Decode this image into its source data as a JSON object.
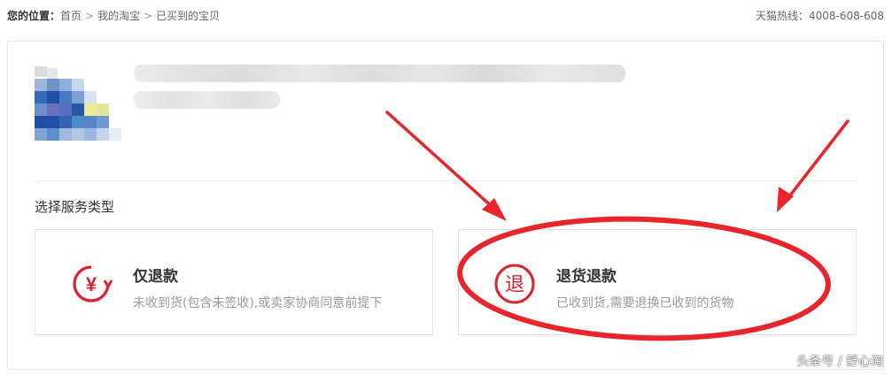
{
  "breadcrumb": {
    "label": "您的位置：",
    "items": [
      "首页",
      "我的淘宝",
      "已买到的宝贝"
    ],
    "separator": ">"
  },
  "hotline": "天猫热线：4008-608-608",
  "service": {
    "title": "选择服务类型",
    "options": [
      {
        "icon": "refund-yuan-icon",
        "title": "仅退款",
        "desc": "未收到货(包含未签收),或卖家协商同意前提下"
      },
      {
        "icon": "return-tui-icon",
        "title": "退货退款",
        "desc": "已收到货,需要退换已收到的货物"
      }
    ]
  },
  "icons": {
    "yuan_glyph": "¥",
    "return_glyph": "退"
  },
  "colors": {
    "accent": "#d9232e",
    "annotation": "#e8252a",
    "muted": "#999999"
  },
  "watermark": "头条号 / 舒心淘"
}
